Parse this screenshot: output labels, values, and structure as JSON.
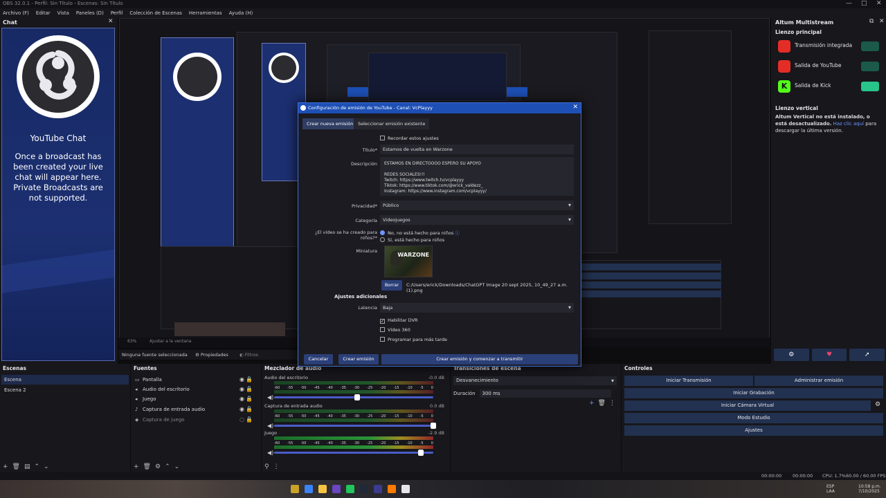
{
  "window": {
    "title": "OBS 32.0.1 - Perfil: Sin Título - Escenas: Sin Título",
    "controls": [
      "—",
      "□",
      "✕"
    ]
  },
  "menu": [
    "Archivo (F)",
    "Editar",
    "Vista",
    "Paneles (D)",
    "Perfil",
    "Colección de Escenas",
    "Herramientas",
    "Ayuda (H)"
  ],
  "chat_dock": {
    "title": "Chat",
    "heading": "YouTube Chat",
    "message": "Once a broadcast has been created your live chat will appear here. Private Broadcasts are not supported."
  },
  "preview_bar": {
    "zoom": "63%",
    "fit": "Ajustar a la ventana",
    "no_source": "Ninguna fuente seleccionada",
    "properties": "Propiedades",
    "filters": "Filtros"
  },
  "altum": {
    "title": "Altum Multistream",
    "main_canvas": "Lienzo principal",
    "outputs": [
      {
        "label": "Transmisión integrada",
        "icon": "youtube-icon",
        "color": "#e52d27",
        "on": false
      },
      {
        "label": "Salida de YouTube",
        "icon": "youtube-icon",
        "color": "#e52d27",
        "on": false
      },
      {
        "label": "Salida de Kick",
        "icon": "kick-icon",
        "color": "#53fc18",
        "on": true
      }
    ],
    "vertical_title": "Lienzo vertical",
    "vertical_note": "Altum Vertical no está instalado, o está desactualizado.",
    "vertical_link": "Haz clic aquí",
    "vertical_link_rest": "para descargar la última versión.",
    "buttons": [
      "⚙",
      "♥",
      "➚"
    ]
  },
  "scenes": {
    "title": "Escenas",
    "items": [
      "Escena",
      "Escena 2"
    ],
    "selected": 0
  },
  "sources": {
    "title": "Fuentes",
    "items": [
      {
        "label": "Pantalla",
        "icon": "monitor-icon"
      },
      {
        "label": "Audio del escritorio",
        "icon": "speaker-icon"
      },
      {
        "label": "Juego",
        "icon": "speaker-icon"
      },
      {
        "label": "Captura de entrada audio",
        "icon": "mic-icon"
      },
      {
        "label": "Captura de juego",
        "icon": "gamepad-icon"
      }
    ]
  },
  "mixer": {
    "title": "Mezclador de audio",
    "tracks": [
      {
        "name": "Audio del escritorio",
        "db": "-0.0 dB",
        "level": 0.52
      },
      {
        "name": "Captura de entrada audio",
        "db": "0.0 dB",
        "level": 1.0
      },
      {
        "name": "Juego",
        "db": "-2.9 dB",
        "level": 0.92
      }
    ],
    "scale": [
      "-60",
      "-55",
      "-50",
      "-45",
      "-40",
      "-35",
      "-30",
      "-25",
      "-20",
      "-15",
      "-10",
      "-5",
      "0"
    ]
  },
  "transitions": {
    "title": "Transiciones de escena",
    "selected": "Desvanecimiento",
    "duration_label": "Duración",
    "duration_value": "300 ms"
  },
  "controls": {
    "title": "Controles",
    "start_stream": "Iniciar Transmisión",
    "manage_stream": "Administrar emisión",
    "start_recording": "Iniciar Grabación",
    "virtual_cam": "Iniciar Cámara Virtual",
    "studio_mode": "Modo Estudio",
    "settings": "Ajustes"
  },
  "statusbar": {
    "rec_time": "00:00:00",
    "stream_time": "00:00:00",
    "cpu": "CPU: 1.7%",
    "fps": "60.00 / 60.00 FPS"
  },
  "taskbar": {
    "lang": "ESP",
    "lang2": "LAA",
    "time": "10:58 p.m.",
    "date": "7/10/2025"
  },
  "dialog": {
    "title": "Configuración de emisión de YouTube - Canal: VcPlayyy",
    "tab_new": "Crear nueva emisión",
    "tab_existing": "Seleccionar emisión existente",
    "remember": "Recordar estos ajustes",
    "title_label": "Título*",
    "title_value": "Estamos de vuelta en Warzone",
    "desc_label": "Descripción",
    "desc_value": "ESTAMOS EN DIRECTOOOO ESPERO SU APOYO\n\nREDES SOCIALES!!!\nTwitch: https://www.twitch.tv/vcplayyy\nTiktok: https://www.tiktok.com/@erick_valdezz_\nInstagram: https://www.instagram.com/vcplayyy/",
    "privacy_label": "Privacidad*",
    "privacy_value": "Público",
    "category_label": "Categoría",
    "category_value": "Videojuegos",
    "kids_label": "¿El vídeo se ha creado para niños?*",
    "kids_no": "No, no está hecho para niños",
    "kids_yes": "Sí, está hecho para niños",
    "thumb_label": "Miniatura",
    "thumb_text": "WARZONE",
    "delete_btn": "Borrar",
    "thumb_path": "C:/Users/erick/Downloads/ChatGPT Image 20 sept 2025, 10_49_27 a.m. (1).png",
    "extra_title": "Ajustes adicionales",
    "latency_label": "Latencia",
    "latency_value": "Baja",
    "dvr": "Habilitar DVR",
    "video360": "Vídeo 360",
    "schedule": "Programar para más tarde",
    "cancel": "Cancelar",
    "create": "Crear emisión",
    "create_start": "Crear emisión y comenzar a transmitir"
  }
}
